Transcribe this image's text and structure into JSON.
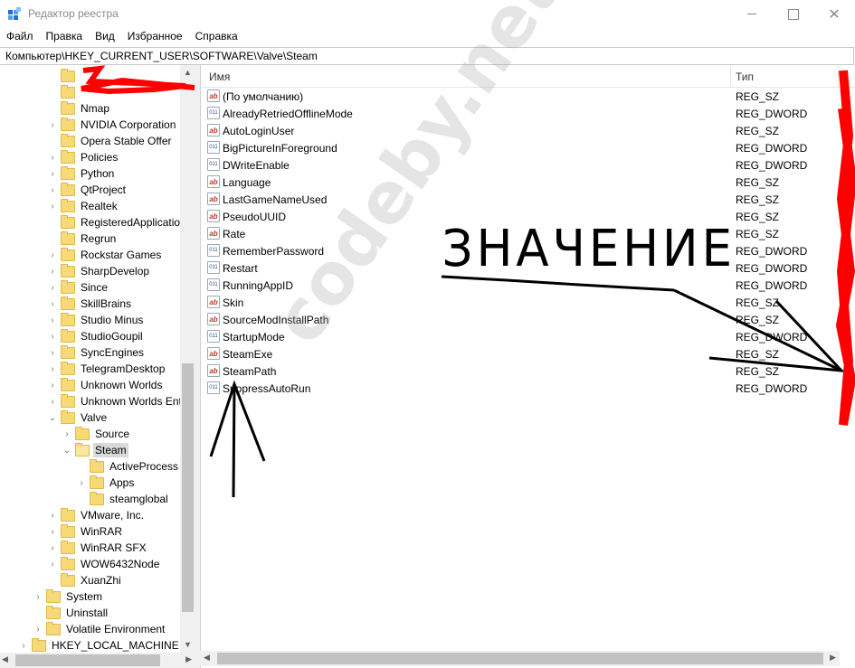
{
  "window": {
    "title": "Редактор реестра",
    "minimize_glyph": "—",
    "maximize_glyph": "□",
    "close_glyph": "✕"
  },
  "menu": [
    "Файл",
    "Правка",
    "Вид",
    "Избранное",
    "Справка"
  ],
  "address": "Компьютер\\HKEY_CURRENT_USER\\SOFTWARE\\Valve\\Steam",
  "tree": {
    "items": [
      {
        "label": "",
        "expander": "",
        "depth": 2
      },
      {
        "label": "",
        "expander": "",
        "depth": 2
      },
      {
        "label": "Nmap",
        "expander": "",
        "depth": 2
      },
      {
        "label": "NVIDIA Corporation",
        "expander": ">",
        "depth": 2
      },
      {
        "label": "Opera Stable Offer",
        "expander": "",
        "depth": 2
      },
      {
        "label": "Policies",
        "expander": ">",
        "depth": 2
      },
      {
        "label": "Python",
        "expander": ">",
        "depth": 2
      },
      {
        "label": "QtProject",
        "expander": ">",
        "depth": 2
      },
      {
        "label": "Realtek",
        "expander": ">",
        "depth": 2
      },
      {
        "label": "RegisteredApplications",
        "expander": "",
        "depth": 2
      },
      {
        "label": "Regrun",
        "expander": "",
        "depth": 2
      },
      {
        "label": "Rockstar Games",
        "expander": ">",
        "depth": 2
      },
      {
        "label": "SharpDevelop",
        "expander": ">",
        "depth": 2
      },
      {
        "label": "Since",
        "expander": ">",
        "depth": 2
      },
      {
        "label": "SkillBrains",
        "expander": ">",
        "depth": 2
      },
      {
        "label": "Studio Minus",
        "expander": ">",
        "depth": 2
      },
      {
        "label": "StudioGoupil",
        "expander": ">",
        "depth": 2
      },
      {
        "label": "SyncEngines",
        "expander": ">",
        "depth": 2
      },
      {
        "label": "TelegramDesktop",
        "expander": ">",
        "depth": 2
      },
      {
        "label": "Unknown Worlds",
        "expander": ">",
        "depth": 2
      },
      {
        "label": "Unknown Worlds Entertainment",
        "expander": ">",
        "depth": 2
      },
      {
        "label": "Valve",
        "expander": "v",
        "depth": 2
      },
      {
        "label": "Source",
        "expander": ">",
        "depth": 3
      },
      {
        "label": "Steam",
        "expander": "v",
        "depth": 3,
        "selected": true
      },
      {
        "label": "ActiveProcess",
        "expander": "",
        "depth": 4
      },
      {
        "label": "Apps",
        "expander": ">",
        "depth": 4
      },
      {
        "label": "steamglobal",
        "expander": "",
        "depth": 4
      },
      {
        "label": "VMware, Inc.",
        "expander": ">",
        "depth": 2
      },
      {
        "label": "WinRAR",
        "expander": ">",
        "depth": 2
      },
      {
        "label": "WinRAR SFX",
        "expander": ">",
        "depth": 2
      },
      {
        "label": "WOW6432Node",
        "expander": ">",
        "depth": 2
      },
      {
        "label": "XuanZhi",
        "expander": "",
        "depth": 2
      },
      {
        "label": "System",
        "expander": ">",
        "depth": 1
      },
      {
        "label": "Uninstall",
        "expander": "",
        "depth": 1
      },
      {
        "label": "Volatile Environment",
        "expander": ">",
        "depth": 1
      },
      {
        "label": "HKEY_LOCAL_MACHINE",
        "expander": ">",
        "depth": 0
      }
    ]
  },
  "list": {
    "col_name": "Имя",
    "col_type": "Тип",
    "rows": [
      {
        "name": "(По умолчанию)",
        "type": "REG_SZ",
        "icon": "string-value-icon"
      },
      {
        "name": "AlreadyRetriedOfflineMode",
        "type": "REG_DWORD",
        "icon": "dword-value-icon"
      },
      {
        "name": "AutoLoginUser",
        "type": "REG_SZ",
        "icon": "string-value-icon"
      },
      {
        "name": "BigPictureInForeground",
        "type": "REG_DWORD",
        "icon": "dword-value-icon"
      },
      {
        "name": "DWriteEnable",
        "type": "REG_DWORD",
        "icon": "dword-value-icon"
      },
      {
        "name": "Language",
        "type": "REG_SZ",
        "icon": "string-value-icon"
      },
      {
        "name": "LastGameNameUsed",
        "type": "REG_SZ",
        "icon": "string-value-icon"
      },
      {
        "name": "PseudoUUID",
        "type": "REG_SZ",
        "icon": "string-value-icon"
      },
      {
        "name": "Rate",
        "type": "REG_SZ",
        "icon": "string-value-icon"
      },
      {
        "name": "RememberPassword",
        "type": "REG_DWORD",
        "icon": "dword-value-icon"
      },
      {
        "name": "Restart",
        "type": "REG_DWORD",
        "icon": "dword-value-icon"
      },
      {
        "name": "RunningAppID",
        "type": "REG_DWORD",
        "icon": "dword-value-icon"
      },
      {
        "name": "Skin",
        "type": "REG_SZ",
        "icon": "string-value-icon"
      },
      {
        "name": "SourceModInstallPath",
        "type": "REG_SZ",
        "icon": "string-value-icon"
      },
      {
        "name": "StartupMode",
        "type": "REG_DWORD",
        "icon": "dword-value-icon"
      },
      {
        "name": "SteamExe",
        "type": "REG_SZ",
        "icon": "string-value-icon"
      },
      {
        "name": "SteamPath",
        "type": "REG_SZ",
        "icon": "string-value-icon"
      },
      {
        "name": "SuppressAutoRun",
        "type": "REG_DWORD",
        "icon": "dword-value-icon"
      }
    ]
  },
  "annotation": {
    "handwritten_text": "ЗНАЧЕНИЕ",
    "watermark": "codeby.net",
    "ink_color": "#000000",
    "redact_color": "#ff0000"
  },
  "scroll": {
    "up": "▲",
    "down": "▼",
    "left": "◀",
    "right": "▶"
  }
}
